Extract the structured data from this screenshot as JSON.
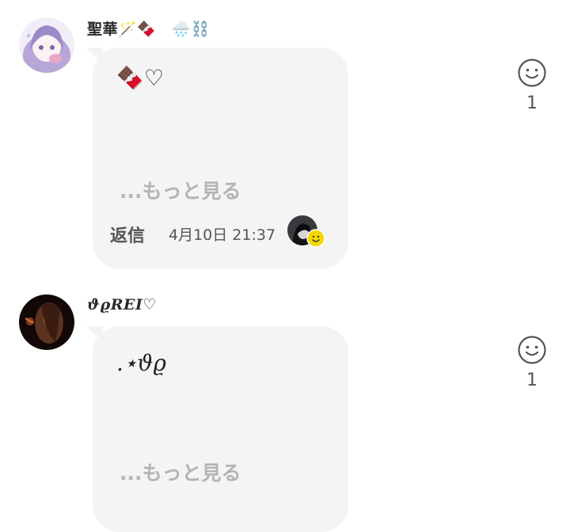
{
  "comments": [
    {
      "username": "聖華🪄🍫　🌧️⛓️",
      "body": "🍫♡",
      "see_more": "...もっと見る",
      "reply_label": "返信",
      "timestamp": "4月10日 21:37",
      "reaction_count": "1",
      "reactor_badge_icon": "smiley-icon",
      "react_icon": "smiley-outline-icon"
    },
    {
      "username": "ϑϱREI♡",
      "body": ".⋆ϑϱ",
      "see_more": "...もっと見る",
      "reaction_count": "1",
      "react_icon": "smiley-outline-icon"
    }
  ],
  "colors": {
    "bubble": "#f4f4f4",
    "see_more": "#b4b4b4",
    "badge": "#f5d800",
    "icon": "#555555"
  }
}
